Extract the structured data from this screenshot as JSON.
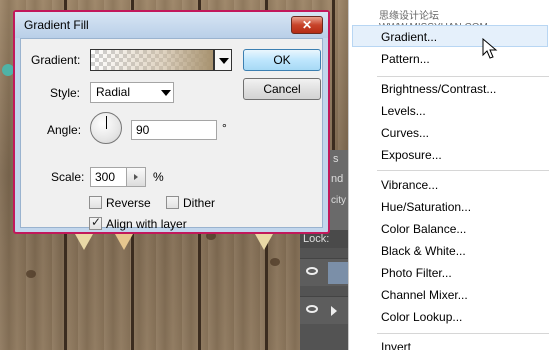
{
  "dialog": {
    "title": "Gradient Fill",
    "close_label": "✕",
    "gradient_label": "Gradient:",
    "style_label": "Style:",
    "style_value": "Radial",
    "angle_label": "Angle:",
    "angle_value": "90",
    "angle_unit": "°",
    "scale_label": "Scale:",
    "scale_value": "300",
    "scale_unit": "%",
    "reverse_label": "Reverse",
    "reverse_checked": false,
    "dither_label": "Dither",
    "dither_checked": false,
    "align_label": "Align with layer",
    "align_checked": true,
    "ok_label": "OK",
    "cancel_label": "Cancel"
  },
  "menu": {
    "watermark": "思缘设计论坛 WWW.MISSYUAN.COM",
    "group1": [
      "Gradient...",
      "Pattern..."
    ],
    "group2": [
      "Brightness/Contrast...",
      "Levels...",
      "Curves...",
      "Exposure..."
    ],
    "group3": [
      "Vibrance...",
      "Hue/Saturation...",
      "Color Balance...",
      "Black & White...",
      "Photo Filter...",
      "Channel Mixer...",
      "Color Lookup..."
    ],
    "group4": [
      "Invert"
    ],
    "hovered": "Gradient..."
  },
  "panel": {
    "lock_label": "Lock:",
    "tab_fragment_1": "s",
    "tab_fragment_2": "nd",
    "tab_fragment_3": "city"
  },
  "colors": {
    "dialog_border": "#c2185b",
    "menu_hover": "#e5f0fb"
  }
}
